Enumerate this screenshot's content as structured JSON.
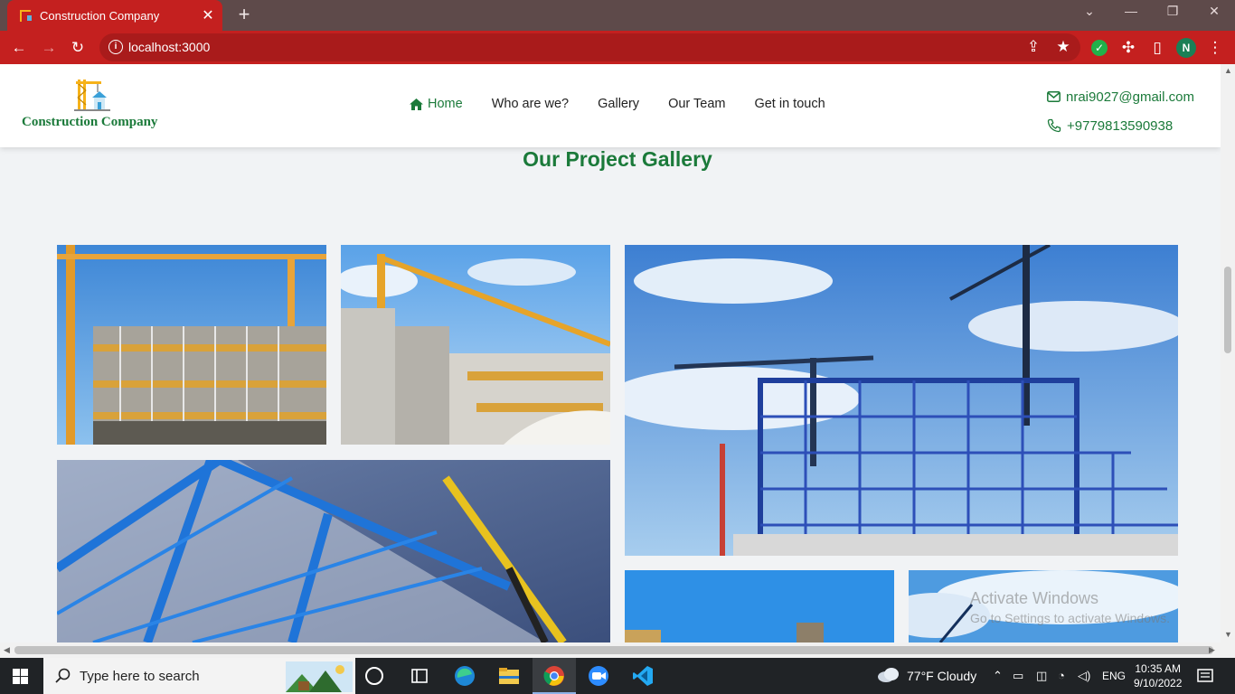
{
  "browser": {
    "tab_title": "Construction Company",
    "url": "localhost:3000",
    "profile_initial": "N"
  },
  "site": {
    "brand": "Construction Company",
    "nav": [
      "Home",
      "Who are we?",
      "Gallery",
      "Our Team",
      "Get in touch"
    ],
    "email": "nrai9027@gmail.com",
    "phone": "+9779813590938",
    "colors": {
      "brand_green": "#1b7a3a",
      "chrome_red": "#c4201f"
    }
  },
  "gallery": {
    "title": "Our Project Gallery"
  },
  "watermark": {
    "title": "Activate Windows",
    "subtitle": "Go to Settings to activate Windows."
  },
  "taskbar": {
    "search_placeholder": "Type here to search",
    "weather": "77°F  Cloudy",
    "lang": "ENG",
    "time": "10:35 AM",
    "date": "9/10/2022"
  }
}
